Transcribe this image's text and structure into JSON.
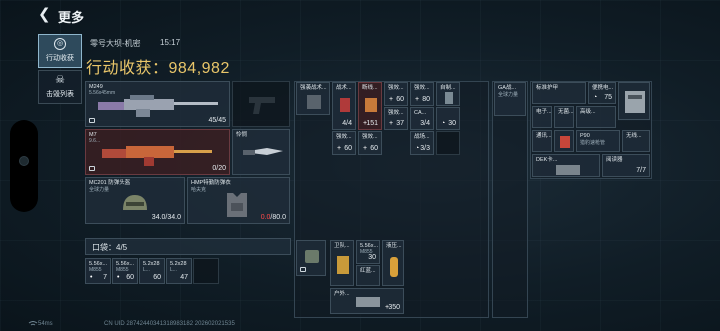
{
  "header": {
    "title": "更多"
  },
  "tabs": [
    {
      "label": "行动收获",
      "active": true
    },
    {
      "label": "击毁列表",
      "active": false
    }
  ],
  "session": {
    "map_name": "零号大坝-机密",
    "time": "15:17",
    "income_label": "行动收获：984,982"
  },
  "weapons": {
    "primary": {
      "name": "M249",
      "caliber": "5.56x45mm",
      "ammo": "45/45"
    },
    "secondary": {
      "name": "M7",
      "caliber": "9.6...",
      "ammo": "0/20"
    },
    "sidearm": {
      "name": ""
    },
    "melee": {
      "name": "怜悯"
    }
  },
  "gear": {
    "helmet": {
      "name": "MC201 防弹头盔",
      "subtitle": "全球力量",
      "durability": "34.0/34.0"
    },
    "armor": {
      "name": "HMP特勤防弹衣",
      "subtitle": "哈夫克",
      "durability_current": "0.0",
      "durability_max": "/80.0"
    }
  },
  "chest_rig": {
    "items": [
      {
        "label": "强袭战术...",
        "count": ""
      },
      {
        "label": "战术...",
        "count": "4/4"
      },
      {
        "label": "断线...",
        "count": "151"
      },
      {
        "label": "强效...",
        "count": "60"
      },
      {
        "label": "强效...",
        "count": "80"
      },
      {
        "label": "自制...",
        "count": ""
      },
      {
        "label": "强效...",
        "count": "37"
      },
      {
        "label": "CA...",
        "count": "3/4"
      },
      {
        "label": "",
        "count": "30"
      },
      {
        "label": "强效...",
        "count": "60"
      },
      {
        "label": "强效...",
        "count": "60"
      },
      {
        "label": "战场...",
        "count": "3/3"
      }
    ]
  },
  "pocket": {
    "label": "口袋：4/5",
    "items": [
      {
        "label": "5.56x...",
        "sub": "M855",
        "count": "7"
      },
      {
        "label": "5.56x...",
        "sub": "M855",
        "count": "60"
      },
      {
        "label": "5.2x28",
        "sub": "L...",
        "count": "60"
      },
      {
        "label": "5.2x28",
        "sub": "L...",
        "count": "47"
      }
    ]
  },
  "backpack": {
    "items": [
      {
        "label": "卫队...",
        "count": ""
      },
      {
        "label": "5.56x...",
        "sub": "M855",
        "count": "30"
      },
      {
        "label": "液压...",
        "count": ""
      },
      {
        "label": "红蓝...",
        "count": ""
      },
      {
        "label": "户外...",
        "count": "350"
      }
    ]
  },
  "safe_box": {
    "items": [
      {
        "label": "GA战...",
        "sub": "全球力量",
        "count": ""
      }
    ]
  },
  "secure_container": {
    "items": [
      {
        "label": "标准护甲",
        "count": ""
      },
      {
        "label": "便携电...",
        "count": "75"
      },
      {
        "label": "电子...",
        "count": ""
      },
      {
        "label": "无菌...",
        "count": ""
      },
      {
        "label": "高级...",
        "count": ""
      },
      {
        "label": "通讯...",
        "count": ""
      },
      {
        "label": "P90",
        "sub": "猎豹速枪管",
        "count": ""
      },
      {
        "label": "无线...",
        "count": ""
      },
      {
        "label": "DEK卡...",
        "count": ""
      },
      {
        "label": "阅读器",
        "count": "7/7"
      }
    ]
  },
  "footer": {
    "ping": "54ms",
    "uid": "CN UID 28742440341318983182 202602021535"
  },
  "colors": {
    "income": "#e9c66a",
    "durability_empty": "#ff4a4a",
    "active_tab": "#2e4a5c"
  }
}
